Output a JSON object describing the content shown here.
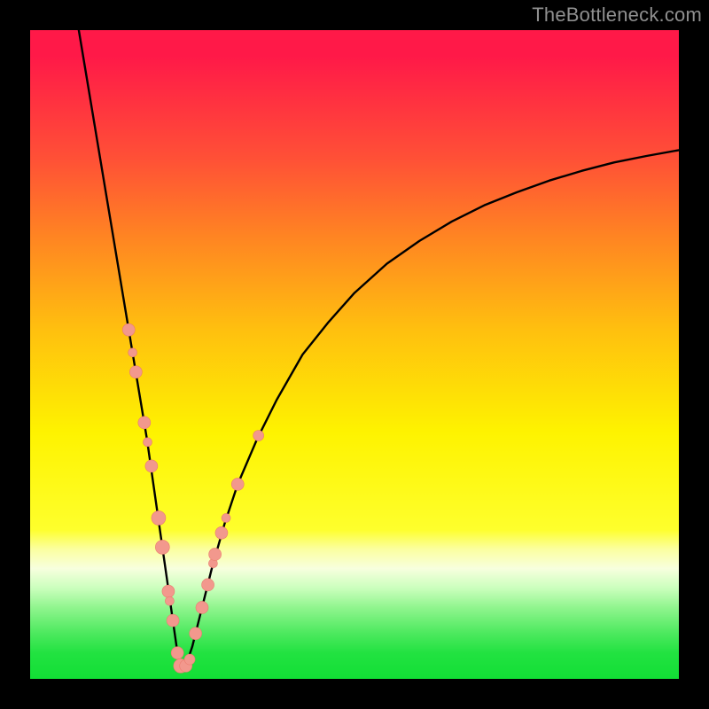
{
  "watermark": "TheBottleneck.com",
  "colors": {
    "curve": "#000000",
    "marker_fill": "#f2988d",
    "marker_stroke": "#ea7c6e",
    "frame_bg": "#000000"
  },
  "chart_data": {
    "type": "line",
    "title": "",
    "xlabel": "",
    "ylabel": "",
    "xlim": [
      0,
      100
    ],
    "ylim": [
      0,
      100
    ],
    "curve": {
      "description": "V-shaped bottleneck curve with minimum near x≈23",
      "x": [
        7.5,
        9,
        10.5,
        12,
        13.5,
        15,
        16.5,
        18,
        19,
        20,
        21,
        22,
        23,
        24,
        25,
        26,
        27,
        28,
        30,
        32,
        35,
        38,
        42,
        46,
        50,
        55,
        60,
        65,
        70,
        75,
        80,
        85,
        90,
        95,
        100
      ],
      "y": [
        100,
        91,
        82,
        73,
        64,
        55,
        46,
        37,
        30,
        23,
        16,
        9,
        2,
        2,
        5,
        9,
        13,
        17,
        24,
        30,
        37,
        43,
        50,
        55,
        59.5,
        64,
        67.5,
        70.5,
        73,
        75,
        76.8,
        78.3,
        79.6,
        80.6,
        81.5
      ]
    },
    "series": [
      {
        "name": "left-branch-markers",
        "type": "scatter",
        "x": [
          15.2,
          15.8,
          16.3,
          17.6,
          18.1,
          18.7,
          19.8,
          20.4,
          21.3,
          21.5,
          22.0,
          22.7,
          23.2,
          24.0
        ],
        "y": [
          53.8,
          50.3,
          47.3,
          39.5,
          36.5,
          32.8,
          24.8,
          20.3,
          13.5,
          12.0,
          9.0,
          4.0,
          2.0,
          2.0
        ],
        "r": [
          7,
          5,
          7,
          7,
          5,
          7,
          8,
          8,
          7,
          5,
          7,
          7,
          8,
          7
        ]
      },
      {
        "name": "right-branch-markers",
        "type": "scatter",
        "x": [
          24.6,
          25.5,
          26.5,
          27.4,
          28.2,
          28.5,
          29.5,
          30.2,
          32.0
        ],
        "y": [
          3.0,
          7.0,
          11.0,
          14.5,
          17.8,
          19.2,
          22.5,
          24.8,
          30.0
        ],
        "r": [
          6,
          7,
          7,
          7,
          5,
          7,
          7,
          5,
          7
        ]
      },
      {
        "name": "outlier-right",
        "type": "scatter",
        "x": [
          35.2
        ],
        "y": [
          37.5
        ],
        "r": [
          6
        ]
      }
    ]
  }
}
